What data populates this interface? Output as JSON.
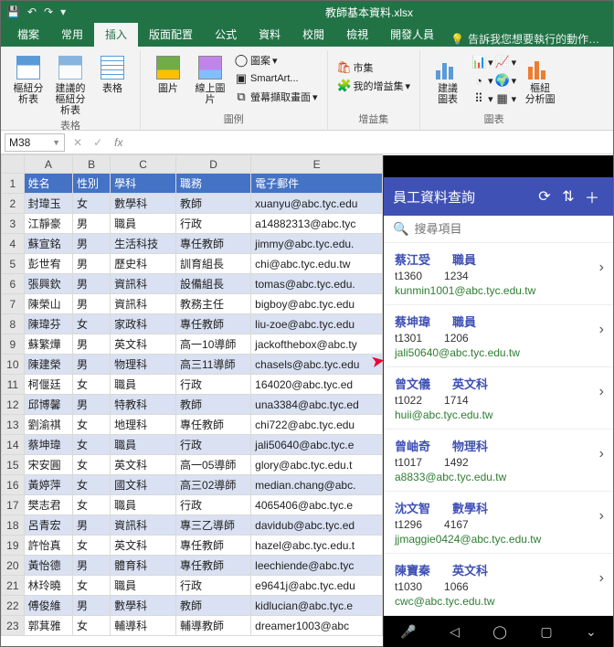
{
  "window": {
    "title": "教師基本資料.xlsx"
  },
  "qat": {
    "save": "💾",
    "undo": "↶",
    "redo": "↷"
  },
  "tabs": {
    "file": "檔案",
    "home": "常用",
    "insert": "插入",
    "layout": "版面配置",
    "formulas": "公式",
    "data": "資料",
    "review": "校閱",
    "view": "檢視",
    "developer": "開發人員",
    "tell": "告訴我您想要執行的動作…"
  },
  "ribbon": {
    "tables_group": "表格",
    "pivot": "樞紐分析表",
    "recpivot_l1": "建議的",
    "recpivot_l2": "樞紐分析表",
    "table": "表格",
    "illus_group": "圖例",
    "pictures": "圖片",
    "online_pic": "線上圖片",
    "shapes": "圖案",
    "smartart": "SmartArt...",
    "screenshot": "螢幕擷取畫面",
    "addins_group": "增益集",
    "store": "市集",
    "myaddins": "我的增益集",
    "charts_group": "圖表",
    "recchart_l1": "建議",
    "recchart_l2": "圖表",
    "pivotchart_l1": "樞紐",
    "pivotchart_l2": "分析圖"
  },
  "namebox": "M38",
  "columns": [
    "A",
    "B",
    "C",
    "D",
    "E"
  ],
  "headers": {
    "name": "姓名",
    "gender": "性別",
    "subject": "學科",
    "job": "職務",
    "email": "電子郵件"
  },
  "rows": [
    {
      "n": "封瑋玉",
      "g": "女",
      "s": "數學科",
      "j": "教師",
      "e": "xuanyu@abc.tyc.edu"
    },
    {
      "n": "江靜豪",
      "g": "男",
      "s": "職員",
      "j": "行政",
      "e": "a14882313@abc.tyc"
    },
    {
      "n": "蘇宣銘",
      "g": "男",
      "s": "生活科技",
      "j": "專任教師",
      "e": "jimmy@abc.tyc.edu."
    },
    {
      "n": "彭世宥",
      "g": "男",
      "s": "歷史科",
      "j": "訓育組長",
      "e": "chi@abc.tyc.edu.tw"
    },
    {
      "n": "張興欽",
      "g": "男",
      "s": "資訊科",
      "j": "設備組長",
      "e": "tomas@abc.tyc.edu."
    },
    {
      "n": "陳榮山",
      "g": "男",
      "s": "資訊科",
      "j": "教務主任",
      "e": "bigboy@abc.tyc.edu"
    },
    {
      "n": "陳瑋芬",
      "g": "女",
      "s": "家政科",
      "j": "專任教師",
      "e": "liu-zoe@abc.tyc.edu"
    },
    {
      "n": "蘇繁燁",
      "g": "男",
      "s": "英文科",
      "j": "高一10導師",
      "e": "jackofthebox@abc.ty"
    },
    {
      "n": "陳建榮",
      "g": "男",
      "s": "物理科",
      "j": "高三11導師",
      "e": "chasels@abc.tyc.edu"
    },
    {
      "n": "柯偃廷",
      "g": "女",
      "s": "職員",
      "j": "行政",
      "e": "164020@abc.tyc.ed"
    },
    {
      "n": "邱博馨",
      "g": "男",
      "s": "特教科",
      "j": "教師",
      "e": "una3384@abc.tyc.ed"
    },
    {
      "n": "劉渝褀",
      "g": "女",
      "s": "地理科",
      "j": "專任教師",
      "e": "chi722@abc.tyc.edu"
    },
    {
      "n": "蔡坤瑋",
      "g": "女",
      "s": "職員",
      "j": "行政",
      "e": "jali50640@abc.tyc.e"
    },
    {
      "n": "宋安圓",
      "g": "女",
      "s": "英文科",
      "j": "高一05導師",
      "e": "glory@abc.tyc.edu.t"
    },
    {
      "n": "黃婷萍",
      "g": "女",
      "s": "國文科",
      "j": "高三02導師",
      "e": "median.chang@abc."
    },
    {
      "n": "樊志君",
      "g": "女",
      "s": "職員",
      "j": "行政",
      "e": "4065406@abc.tyc.e"
    },
    {
      "n": "呂青宏",
      "g": "男",
      "s": "資訊科",
      "j": "專三乙導師",
      "e": "davidub@abc.tyc.ed"
    },
    {
      "n": "許怡真",
      "g": "女",
      "s": "英文科",
      "j": "專任教師",
      "e": "hazel@abc.tyc.edu.t"
    },
    {
      "n": "黃怡德",
      "g": "男",
      "s": "體育科",
      "j": "專任教師",
      "e": "leechiende@abc.tyc"
    },
    {
      "n": "林玲曉",
      "g": "女",
      "s": "職員",
      "j": "行政",
      "e": "e9641j@abc.tyc.edu"
    },
    {
      "n": "傅俊維",
      "g": "男",
      "s": "數學科",
      "j": "教師",
      "e": "kidlucian@abc.tyc.e"
    },
    {
      "n": "郭萁雅",
      "g": "女",
      "s": "輔導科",
      "j": "輔導教師",
      "e": "dreamer1003@abc"
    }
  ],
  "mobile": {
    "title": "員工資料查詢",
    "search_ph": "搜尋項目",
    "cards": [
      {
        "name": "蔡江受",
        "dept": "職員",
        "id": "t1360",
        "code": "1234",
        "email": "kunmin1001@abc.tyc.edu.tw"
      },
      {
        "name": "蔡坤瑋",
        "dept": "職員",
        "id": "t1301",
        "code": "1206",
        "email": "jali50640@abc.tyc.edu.tw"
      },
      {
        "name": "曾文儀",
        "dept": "英文科",
        "id": "t1022",
        "code": "1714",
        "email": "huii@abc.tyc.edu.tw"
      },
      {
        "name": "曾岫奇",
        "dept": "物理科",
        "id": "t1017",
        "code": "1492",
        "email": "a8833@abc.tyc.edu.tw"
      },
      {
        "name": "沈文智",
        "dept": "數學科",
        "id": "t1296",
        "code": "4167",
        "email": "jjmaggie0424@abc.tyc.edu.tw"
      },
      {
        "name": "陳寶秦",
        "dept": "英文科",
        "id": "t1030",
        "code": "1066",
        "email": "cwc@abc.tyc.edu.tw"
      }
    ]
  }
}
